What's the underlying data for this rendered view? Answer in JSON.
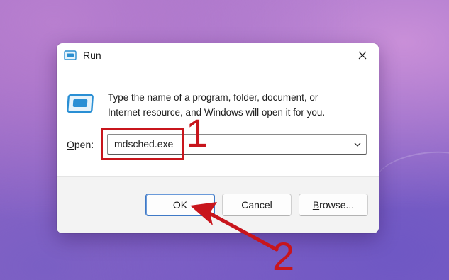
{
  "dialog": {
    "title": "Run",
    "description_line1": "Type the name of a program, folder, document, or",
    "description_line2": "Internet resource, and Windows will open it for you.",
    "open_label_prefix": "",
    "open_label_mnemonic": "O",
    "open_label_suffix": "pen:",
    "open_value": "mdsched.exe",
    "buttons": {
      "ok": "OK",
      "cancel": "Cancel",
      "browse_mnemonic": "B",
      "browse_rest": "rowse..."
    },
    "icons": {
      "title": "run-icon",
      "close": "close-icon",
      "dropdown": "chevron-down-icon",
      "main": "run-window-icon"
    }
  },
  "annotations": {
    "step1": "1",
    "step2": "2",
    "color": "#c8151c"
  }
}
